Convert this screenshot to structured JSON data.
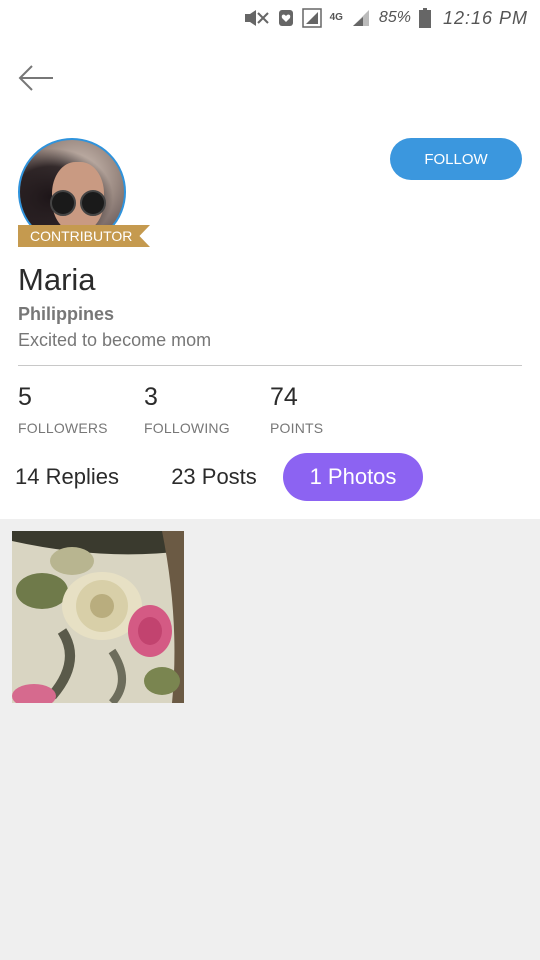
{
  "status_bar": {
    "network": "4G",
    "battery": "85%",
    "time": "12:16 PM"
  },
  "profile": {
    "badge": "CONTRIBUTOR",
    "name": "Maria",
    "location": "Philippines",
    "bio": "Excited to become mom",
    "follow_label": "FOLLOW"
  },
  "stats": {
    "followers": {
      "value": "5",
      "label": "FOLLOWERS"
    },
    "following": {
      "value": "3",
      "label": "FOLLOWING"
    },
    "points": {
      "value": "74",
      "label": "POINTS"
    }
  },
  "tabs": [
    {
      "label": "14 Replies",
      "active": false
    },
    {
      "label": "23 Posts",
      "active": false
    },
    {
      "label": "1 Photos",
      "active": true
    }
  ],
  "colors": {
    "follow_button": "#3b97de",
    "active_tab": "#8c63f2",
    "badge": "#c59a4f",
    "avatar_ring": "#2f93dc"
  },
  "icons": {
    "back": "arrow-left-icon",
    "mute": "mute-icon",
    "notification": "notification-icon",
    "signal": "signal-icon",
    "battery": "battery-icon"
  }
}
